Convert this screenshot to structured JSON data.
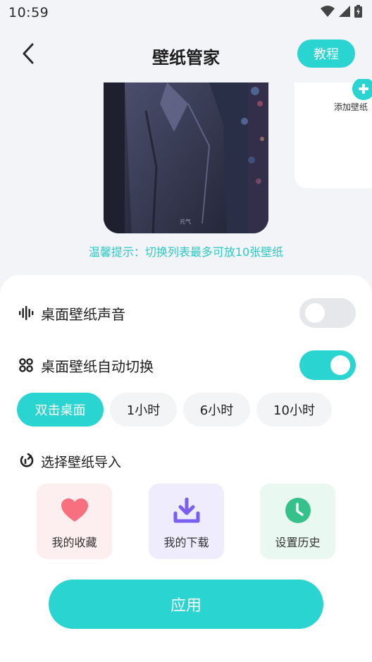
{
  "status_bar": {
    "time": "10:59",
    "icons": [
      "wifi-icon",
      "signal-icon",
      "battery-icon"
    ]
  },
  "header": {
    "title": "壁纸管家",
    "back_icon": "chevron-left-icon",
    "tutorial_label": "教程"
  },
  "wallpaper": {
    "watermark": "元气"
  },
  "add_wallpaper": {
    "label": "添加壁纸",
    "icon": "plus-circle-icon"
  },
  "tip": "温馨提示：切换列表最多可放10张壁纸",
  "settings": {
    "sound": {
      "label": "桌面壁纸声音",
      "icon": "soundwave-icon",
      "enabled": false
    },
    "auto_switch": {
      "label": "桌面壁纸自动切换",
      "icon": "four-dots-icon",
      "enabled": true
    }
  },
  "intervals": [
    {
      "label": "双击桌面",
      "active": true
    },
    {
      "label": "1小时",
      "active": false
    },
    {
      "label": "6小时",
      "active": false
    },
    {
      "label": "10小时",
      "active": false
    }
  ],
  "import": {
    "title": "选择壁纸导入",
    "icon": "refresh-icon",
    "sources": [
      {
        "label": "我的收藏",
        "icon": "heart-icon"
      },
      {
        "label": "我的下载",
        "icon": "download-icon"
      },
      {
        "label": "设置历史",
        "icon": "clock-icon"
      }
    ]
  },
  "apply_label": "应用",
  "colors": {
    "accent": "#2ad4d0",
    "tip_text": "#2ec9c4",
    "favorite_bg": "#fdeef0",
    "favorite_icon": "#f8707f",
    "download_bg": "#efecfd",
    "download_icon": "#7a5ef0",
    "history_bg": "#eaf8f2",
    "history_icon": "#36c08a"
  }
}
